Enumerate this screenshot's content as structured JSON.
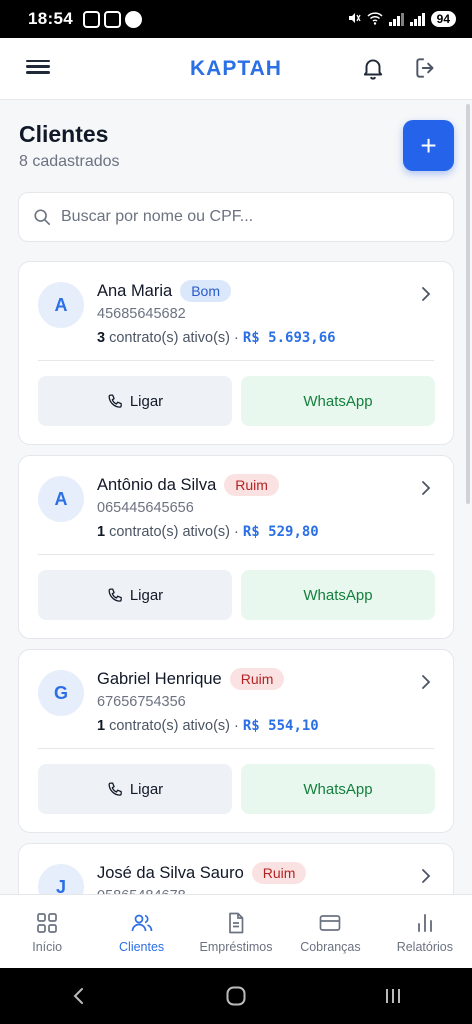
{
  "status_bar": {
    "time": "18:54",
    "battery": "94"
  },
  "header": {
    "brand": "KAPTAH"
  },
  "page": {
    "title": "Clientes",
    "subtitle": "8 cadastrados",
    "add_label": "+"
  },
  "search": {
    "placeholder": "Buscar por nome ou CPF..."
  },
  "clients": [
    {
      "initial": "A",
      "name": "Ana Maria",
      "status": "Bom",
      "cpf": "45685645682",
      "contracts_count": "3",
      "contracts_text": "contrato(s) ativo(s) ·",
      "amount": "R$ 5.693,66",
      "call_label": "Ligar",
      "whatsapp_label": "WhatsApp"
    },
    {
      "initial": "A",
      "name": "Antônio da Silva",
      "status": "Ruim",
      "cpf": "065445645656",
      "contracts_count": "1",
      "contracts_text": "contrato(s) ativo(s) ·",
      "amount": "R$ 529,80",
      "call_label": "Ligar",
      "whatsapp_label": "WhatsApp"
    },
    {
      "initial": "G",
      "name": "Gabriel Henrique",
      "status": "Ruim",
      "cpf": "67656754356",
      "contracts_count": "1",
      "contracts_text": "contrato(s) ativo(s) ·",
      "amount": "R$ 554,10",
      "call_label": "Ligar",
      "whatsapp_label": "WhatsApp"
    },
    {
      "initial": "J",
      "name": "José da Silva Sauro",
      "status": "Ruim",
      "cpf": "05865484678"
    }
  ],
  "bottom_nav": [
    {
      "label": "Início",
      "icon": "grid-icon"
    },
    {
      "label": "Clientes",
      "icon": "users-icon",
      "active": true
    },
    {
      "label": "Empréstimos",
      "icon": "document-icon"
    },
    {
      "label": "Cobranças",
      "icon": "card-icon"
    },
    {
      "label": "Relatórios",
      "icon": "chart-icon"
    }
  ],
  "colors": {
    "accent": "#2b6fe6",
    "primary_button": "#2563eb",
    "good_badge": "#dbe7fb",
    "bad_badge": "#fbe2e2",
    "whatsapp_bg": "#e8f8ef"
  }
}
